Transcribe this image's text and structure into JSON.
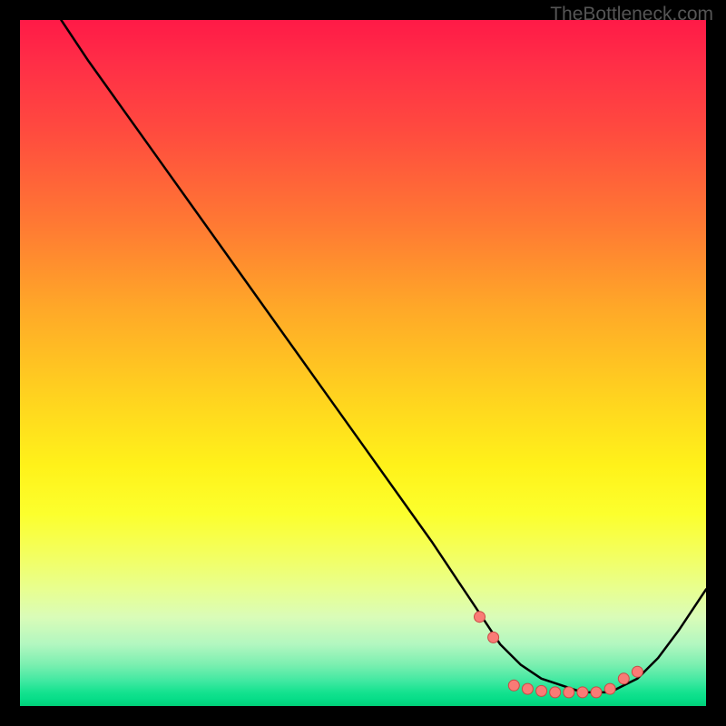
{
  "watermark": "TheBottleneck.com",
  "chart_data": {
    "type": "line",
    "title": "",
    "xlabel": "",
    "ylabel": "",
    "xlim": [
      0,
      100
    ],
    "ylim": [
      0,
      100
    ],
    "series": [
      {
        "name": "curve",
        "x": [
          6,
          10,
          15,
          20,
          25,
          30,
          35,
          40,
          45,
          50,
          55,
          60,
          62,
          64,
          66,
          68,
          70,
          73,
          76,
          79,
          82,
          84,
          86,
          88,
          90,
          93,
          96,
          100
        ],
        "y": [
          100,
          94,
          87,
          80,
          73,
          66,
          59,
          52,
          45,
          38,
          31,
          24,
          21,
          18,
          15,
          12,
          9,
          6,
          4,
          3,
          2,
          2,
          2,
          3,
          4,
          7,
          11,
          17
        ]
      }
    ],
    "markers": {
      "name": "dots",
      "x": [
        67,
        69,
        72,
        74,
        76,
        78,
        80,
        82,
        84,
        86,
        88,
        90
      ],
      "y": [
        13,
        10,
        3,
        2.5,
        2.2,
        2,
        2,
        2,
        2,
        2.5,
        4,
        5
      ]
    },
    "gradient_stops": [
      {
        "pos": 0,
        "color": "#ff1a47"
      },
      {
        "pos": 50,
        "color": "#ffd31f"
      },
      {
        "pos": 75,
        "color": "#fcff2d"
      },
      {
        "pos": 100,
        "color": "#00cf78"
      }
    ]
  }
}
